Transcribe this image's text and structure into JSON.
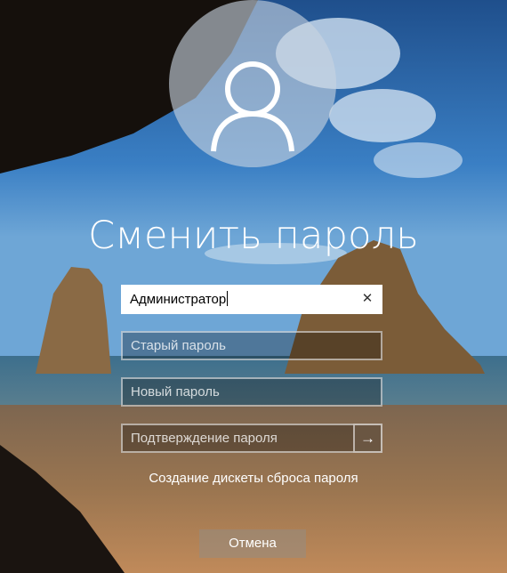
{
  "screen": {
    "title": "Сменить пароль"
  },
  "form": {
    "username_value": "Администратор",
    "old_password_placeholder": "Старый пароль",
    "new_password_placeholder": "Новый пароль",
    "confirm_password_placeholder": "Подтверждение пароля",
    "clear_symbol": "✕",
    "submit_symbol": "→"
  },
  "links": {
    "reset_disk": "Создание дискеты сброса пароля"
  },
  "buttons": {
    "cancel": "Отмена"
  },
  "icons": {
    "avatar": "user-icon",
    "clear": "close-icon",
    "submit": "arrow-right-icon"
  },
  "colors": {
    "text": "#ffffff",
    "field_border": "#ffffff",
    "sky": "#2e6bb0",
    "sand": "#8a6a4a"
  }
}
